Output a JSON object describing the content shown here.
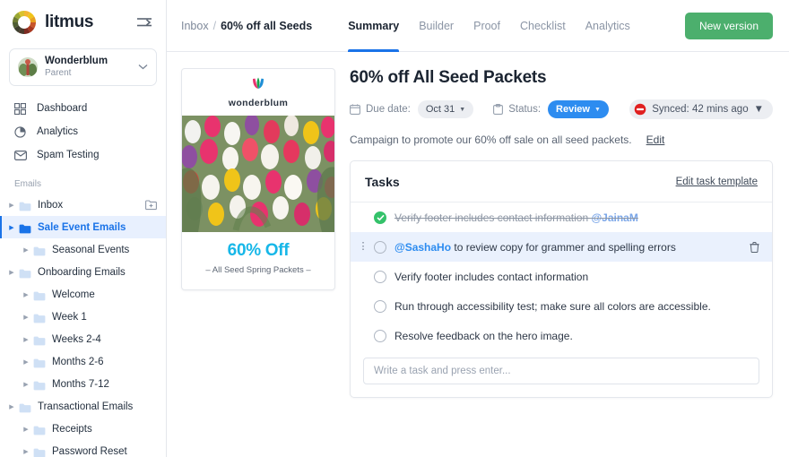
{
  "sidebar": {
    "brand": "litmus",
    "collapse_icon": "collapse-sidebar-icon",
    "account": {
      "name": "Wonderblum",
      "role": "Parent",
      "chevron": "▼"
    },
    "nav": [
      {
        "label": "Dashboard",
        "icon": "grid-icon"
      },
      {
        "label": "Analytics",
        "icon": "pie-chart-icon"
      },
      {
        "label": "Spam Testing",
        "icon": "envelope-icon"
      }
    ],
    "section_label": "Emails",
    "tree": [
      {
        "label": "Inbox",
        "indent": 0,
        "active": false,
        "action_icon": "add-folder-icon"
      },
      {
        "label": "Sale Event Emails",
        "indent": 0,
        "active": true
      },
      {
        "label": "Seasonal Events",
        "indent": 1,
        "active": false
      },
      {
        "label": "Onboarding Emails",
        "indent": 0,
        "active": false
      },
      {
        "label": "Welcome",
        "indent": 1,
        "active": false
      },
      {
        "label": "Week 1",
        "indent": 1,
        "active": false
      },
      {
        "label": "Weeks 2-4",
        "indent": 1,
        "active": false
      },
      {
        "label": "Months 2-6",
        "indent": 1,
        "active": false
      },
      {
        "label": "Months 7-12",
        "indent": 1,
        "active": false
      },
      {
        "label": "Transactional Emails",
        "indent": 0,
        "active": false
      },
      {
        "label": "Receipts",
        "indent": 1,
        "active": false
      },
      {
        "label": "Password Reset",
        "indent": 1,
        "active": false
      }
    ]
  },
  "topbar": {
    "breadcrumb_root": "Inbox",
    "breadcrumb_sep": "/",
    "breadcrumb_current": "60% off all Seeds",
    "tabs": [
      {
        "label": "Summary",
        "active": true
      },
      {
        "label": "Builder",
        "active": false
      },
      {
        "label": "Proof",
        "active": false
      },
      {
        "label": "Checklist",
        "active": false
      },
      {
        "label": "Analytics",
        "active": false
      }
    ],
    "new_version_label": "New version"
  },
  "preview": {
    "brand": "wonderblum",
    "logo_icon": "tulip-logo-icon",
    "hero_alt": "tulips-photo",
    "offer": "60% Off",
    "subtitle": "– All Seed Spring Packets –"
  },
  "detail": {
    "title": "60% off All Seed Packets",
    "due_label": "Due date:",
    "due_value": "Oct 31",
    "due_icon": "calendar-icon",
    "status_label": "Status:",
    "status_value": "Review",
    "status_icon": "clipboard-icon",
    "sync_text": "Synced: 42 mins ago",
    "sync_icon": "sync-blocked-icon",
    "description": "Campaign to promote our 60% off sale on all seed packets.",
    "description_edit": "Edit"
  },
  "tasks": {
    "title": "Tasks",
    "edit_template": "Edit task template",
    "items": [
      {
        "text": "Verify footer includes contact information ",
        "mention": "@JainaM",
        "mention_pos": "end",
        "done": true,
        "hover": false
      },
      {
        "text": " to review copy for grammer and spelling errors",
        "mention": "@SashaHo",
        "mention_pos": "start",
        "done": false,
        "hover": true
      },
      {
        "text": "Verify footer includes contact information",
        "mention": "",
        "mention_pos": "none",
        "done": false,
        "hover": false
      },
      {
        "text": "Run through accessibility test; make sure all colors are accessible.",
        "mention": "",
        "mention_pos": "none",
        "done": false,
        "hover": false
      },
      {
        "text": "Resolve feedback on the hero image.",
        "mention": "",
        "mention_pos": "none",
        "done": false,
        "hover": false
      }
    ],
    "input_placeholder": "Write a task and press enter...",
    "input_value": "",
    "delete_icon": "trash-icon",
    "drag_icon": "drag-handle-icon"
  },
  "colors": {
    "accent_blue": "#1a73e8",
    "status_blue": "#2d8cf0",
    "green_button": "#4caf6d",
    "done_green": "#34c26a",
    "offer_cyan": "#17b7e8",
    "sync_red": "#e02020"
  }
}
